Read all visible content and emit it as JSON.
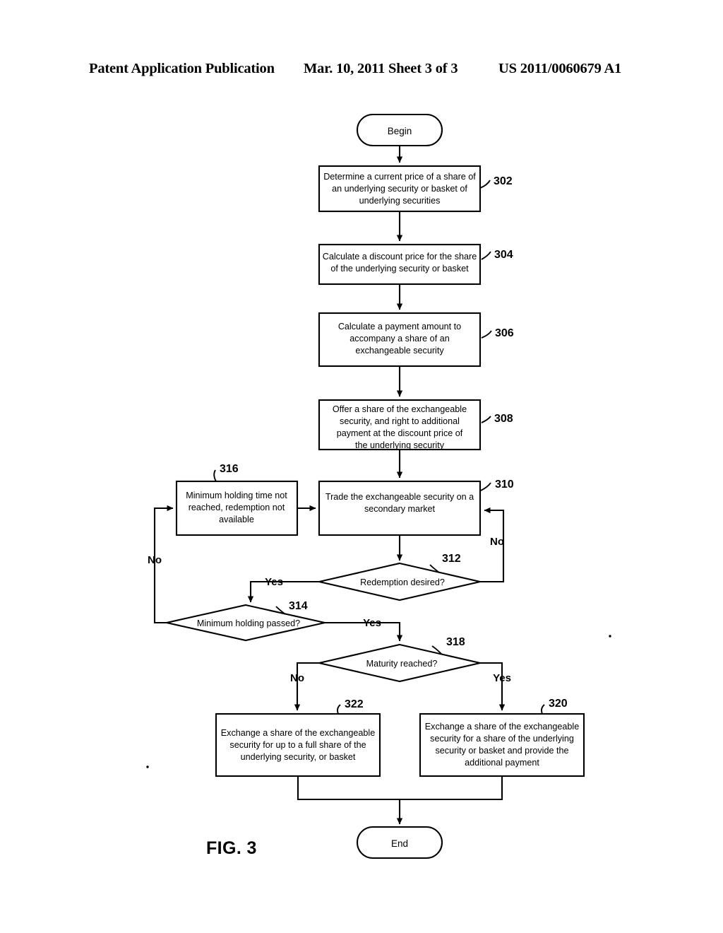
{
  "header": {
    "left": "Patent Application Publication",
    "middle": "Mar. 10, 2011  Sheet 3 of 3",
    "right": "US 2011/0060679 A1"
  },
  "figure": {
    "caption": "FIG. 3",
    "type": "flowchart"
  },
  "flowchart": {
    "terminals": {
      "begin": "Begin",
      "end": "End"
    },
    "nodes": [
      {
        "ref": "302",
        "shape": "process",
        "lines": [
          "Determine a current price of a share of",
          "an underlying security or basket of",
          "underlying securities"
        ]
      },
      {
        "ref": "304",
        "shape": "process",
        "lines": [
          "Calculate a discount price for the share",
          "of the underlying security or basket"
        ]
      },
      {
        "ref": "306",
        "shape": "process",
        "lines": [
          "Calculate a payment amount to",
          "accompany a share of an",
          "exchangeable security"
        ]
      },
      {
        "ref": "308",
        "shape": "process",
        "lines": [
          "Offer a share of the exchangeable",
          "security, and right to additional",
          "payment at the discount price of",
          "the underlying security"
        ]
      },
      {
        "ref": "310",
        "shape": "process",
        "lines": [
          "Trade the exchangeable security on a",
          "secondary market"
        ]
      },
      {
        "ref": "312",
        "shape": "decision",
        "lines": [
          "Redemption desired?"
        ]
      },
      {
        "ref": "314",
        "shape": "decision",
        "lines": [
          "Minimum holding passed?"
        ]
      },
      {
        "ref": "316",
        "shape": "process",
        "lines": [
          "Minimum holding time not",
          "reached, redemption not",
          "available"
        ]
      },
      {
        "ref": "318",
        "shape": "decision",
        "lines": [
          "Maturity reached?"
        ]
      },
      {
        "ref": "320",
        "shape": "process",
        "lines": [
          "Exchange a share of the exchangeable",
          "security for a share of the underlying",
          "security or basket and provide the",
          "additional payment"
        ]
      },
      {
        "ref": "322",
        "shape": "process",
        "lines": [
          "Exchange a share of the exchangeable",
          "security for up to a full share of the",
          "underlying security, or basket"
        ]
      }
    ],
    "branch_labels": {
      "d312_yes": "Yes",
      "d312_no": "No",
      "d314_yes": "Yes",
      "d314_no": "No",
      "d318_no": "No",
      "d318_yes": "Yes"
    }
  }
}
